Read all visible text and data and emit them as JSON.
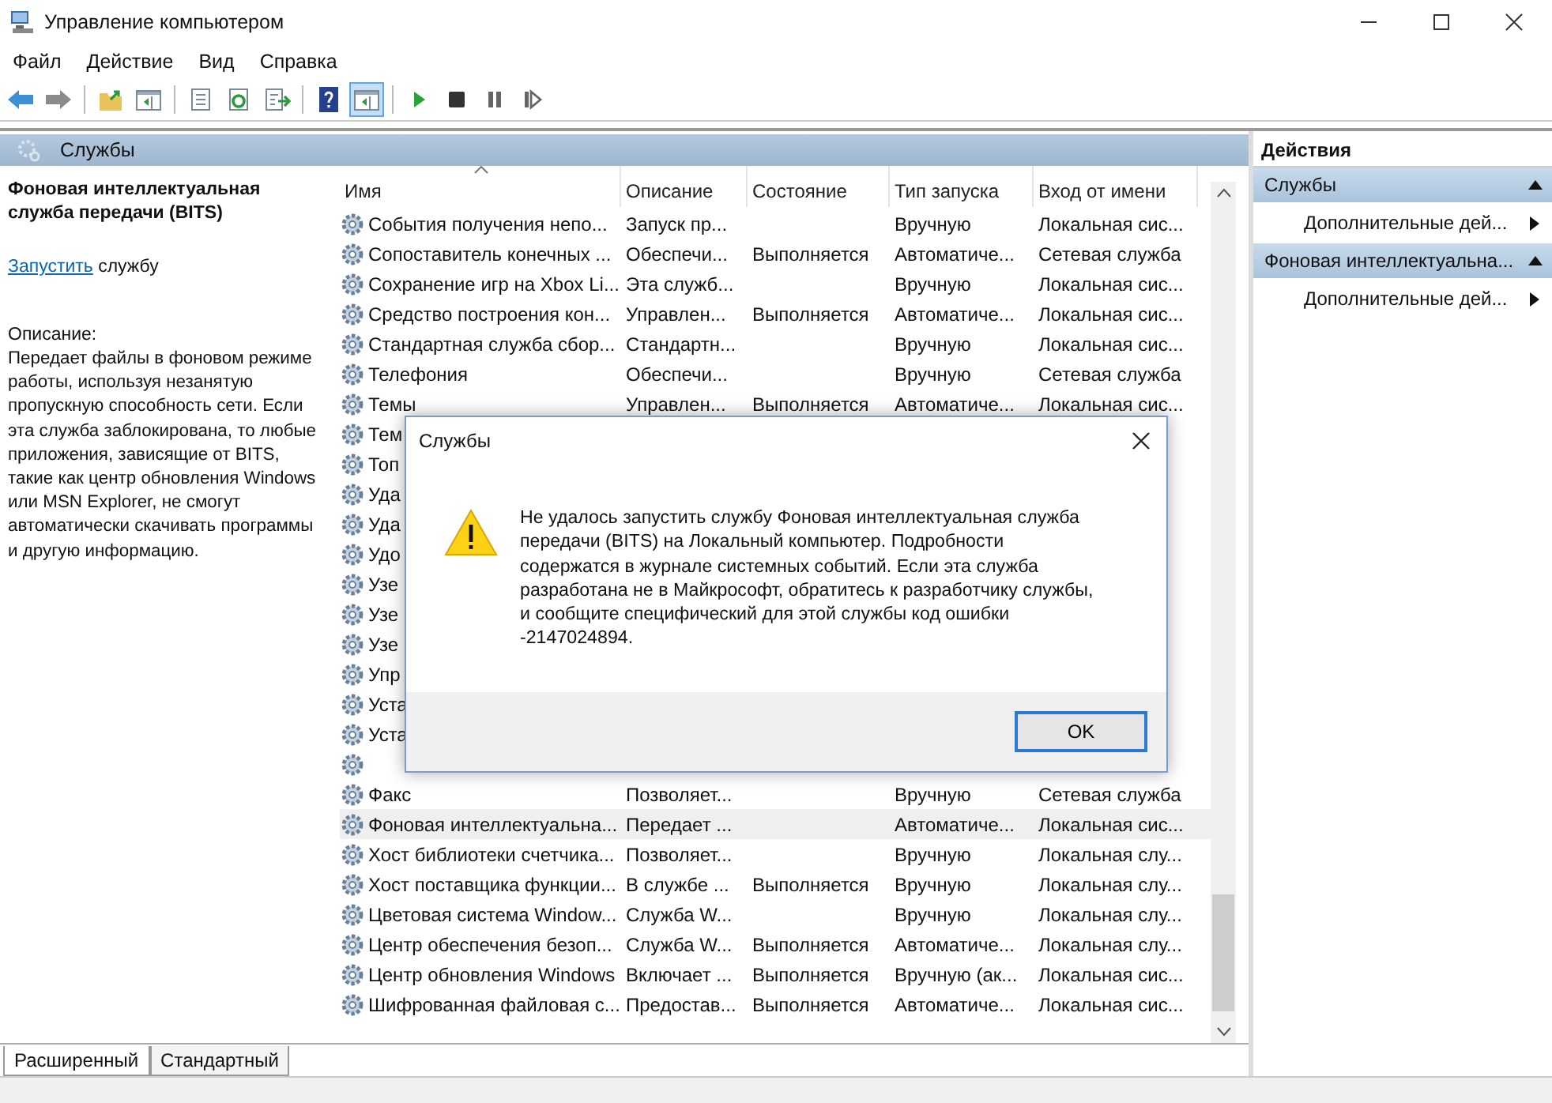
{
  "window": {
    "title": "Управление компьютером"
  },
  "menu": [
    "Файл",
    "Действие",
    "Вид",
    "Справка"
  ],
  "toolbar": [
    {
      "buttons": [
        {
          "kind": "back",
          "selected": false
        },
        {
          "kind": "forward",
          "selected": false
        }
      ]
    },
    {
      "buttons": [
        {
          "kind": "folder",
          "selected": false
        },
        {
          "kind": "panel",
          "selected": false
        }
      ]
    },
    {
      "buttons": [
        {
          "kind": "sheet",
          "selected": false
        },
        {
          "kind": "refresh",
          "selected": false
        },
        {
          "kind": "export",
          "selected": false
        }
      ]
    },
    {
      "buttons": [
        {
          "kind": "help",
          "selected": false
        },
        {
          "kind": "panel",
          "selected": true
        }
      ]
    },
    {
      "buttons": [
        {
          "kind": "play",
          "selected": false
        },
        {
          "kind": "stop",
          "selected": false
        },
        {
          "kind": "pause",
          "selected": false
        },
        {
          "kind": "resume",
          "selected": false
        }
      ]
    }
  ],
  "header": {
    "title": "Службы"
  },
  "details": {
    "title": "Фоновая интеллектуальная служба передачи (BITS)",
    "link": "Запустить",
    "link_rest": "службу",
    "description_label": "Описание:",
    "description": "Передает файлы в фоновом режиме работы, используя незанятую пропускную способность сети. Если эта служба заблокирована, то любые приложения, зависящие от BITS, такие как центр обновления Windows или MSN Explorer, не смогут автоматически скачивать программы и другую информацию."
  },
  "table": {
    "columns": [
      {
        "label": "Имя",
        "sorted": true
      },
      {
        "label": "Описание",
        "sorted": false
      },
      {
        "label": "Состояние",
        "sorted": false
      },
      {
        "label": "Тип запуска",
        "sorted": false
      },
      {
        "label": "Вход от имени",
        "sorted": false
      }
    ],
    "rows": [
      {
        "name": "События получения непо...",
        "description": "Запуск пр...",
        "status": "",
        "startup": "Вручную",
        "logon": "Локальная сис...",
        "selected": false
      },
      {
        "name": "Сопоставитель конечных ...",
        "description": "Обеспечи...",
        "status": "Выполняется",
        "startup": "Автоматиче...",
        "logon": "Сетевая служба",
        "selected": false
      },
      {
        "name": "Сохранение игр на Xbox Li...",
        "description": "Эта служб...",
        "status": "",
        "startup": "Вручную",
        "logon": "Локальная сис...",
        "selected": false
      },
      {
        "name": "Средство построения кон...",
        "description": "Управлен...",
        "status": "Выполняется",
        "startup": "Автоматиче...",
        "logon": "Локальная сис...",
        "selected": false
      },
      {
        "name": "Стандартная служба сбор...",
        "description": "Стандартн...",
        "status": "",
        "startup": "Вручную",
        "logon": "Локальная сис...",
        "selected": false
      },
      {
        "name": "Телефония",
        "description": "Обеспечи...",
        "status": "",
        "startup": "Вручную",
        "logon": "Сетевая служба",
        "selected": false
      },
      {
        "name": "Темы",
        "description": "Управлен...",
        "status": "Выполняется",
        "startup": "Автоматиче...",
        "logon": "Локальная сис...",
        "selected": false
      },
      {
        "name": "Тем",
        "description": "",
        "status": "",
        "startup": "",
        "logon": "",
        "selected": false
      },
      {
        "name": "Топ",
        "description": "",
        "status": "",
        "startup": "",
        "logon": "",
        "selected": false
      },
      {
        "name": "Уда",
        "description": "",
        "status": "",
        "startup": "",
        "logon": "",
        "selected": false
      },
      {
        "name": "Уда",
        "description": "",
        "status": "",
        "startup": "",
        "logon": "",
        "selected": false
      },
      {
        "name": "Удо",
        "description": "",
        "status": "",
        "startup": "",
        "logon": "",
        "selected": false
      },
      {
        "name": "Узе",
        "description": "",
        "status": "",
        "startup": "",
        "logon": "",
        "selected": false
      },
      {
        "name": "Узе",
        "description": "",
        "status": "",
        "startup": "",
        "logon": "",
        "selected": false
      },
      {
        "name": "Узе",
        "description": "",
        "status": "",
        "startup": "",
        "logon": "",
        "selected": false
      },
      {
        "name": "Упр",
        "description": "",
        "status": "",
        "startup": "",
        "logon": "",
        "selected": false
      },
      {
        "name": "Уста",
        "description": "",
        "status": "",
        "startup": "",
        "logon": "",
        "selected": false
      },
      {
        "name": "Уста",
        "description": "",
        "status": "",
        "startup": "",
        "logon": "",
        "selected": false
      },
      {
        "name": "",
        "description": "",
        "status": "",
        "startup": "",
        "logon": "",
        "selected": false
      },
      {
        "name": "Факс",
        "description": "Позволяет...",
        "status": "",
        "startup": "Вручную",
        "logon": "Сетевая служба",
        "selected": false
      },
      {
        "name": "Фоновая интеллектуальна...",
        "description": "Передает ...",
        "status": "",
        "startup": "Автоматиче...",
        "logon": "Локальная сис...",
        "selected": true
      },
      {
        "name": "Хост библиотеки счетчика...",
        "description": "Позволяет...",
        "status": "",
        "startup": "Вручную",
        "logon": "Локальная слу...",
        "selected": false
      },
      {
        "name": "Хост поставщика функции...",
        "description": "В службе ...",
        "status": "Выполняется",
        "startup": "Вручную",
        "logon": "Локальная слу...",
        "selected": false
      },
      {
        "name": "Цветовая система Window...",
        "description": "Служба W...",
        "status": "",
        "startup": "Вручную",
        "logon": "Локальная слу...",
        "selected": false
      },
      {
        "name": "Центр обеспечения безоп...",
        "description": "Служба W...",
        "status": "Выполняется",
        "startup": "Автоматиче...",
        "logon": "Локальная слу...",
        "selected": false
      },
      {
        "name": "Центр обновления Windows",
        "description": "Включает ...",
        "status": "Выполняется",
        "startup": "Вручную (ак...",
        "logon": "Локальная сис...",
        "selected": false
      },
      {
        "name": "Шифрованная файловая с...",
        "description": "Предостав...",
        "status": "Выполняется",
        "startup": "Автоматиче...",
        "logon": "Локальная сис...",
        "selected": false
      }
    ]
  },
  "tabs": [
    {
      "label": "Расширенный",
      "selected": true
    },
    {
      "label": "Стандартный",
      "selected": false
    }
  ],
  "actions": {
    "title": "Действия",
    "groups": [
      {
        "label": "Службы",
        "expanded": true,
        "items": [
          "Дополнительные дей..."
        ]
      },
      {
        "label": "Фоновая интеллектуальна...",
        "expanded": true,
        "items": [
          "Дополнительные дей..."
        ]
      }
    ]
  },
  "dialog": {
    "title": "Службы",
    "message": "Не удалось запустить службу Фоновая интеллектуальная служба\nпередачи (BITS) на Локальный компьютер. Подробности\nсодержатся в журнале системных событий. Если эта служба\nразработана не в Майкрософт, обратитесь к разработчику службы,\nи сообщите специфический для этой службы код ошибки\n-2147024894.",
    "button": "OK"
  }
}
